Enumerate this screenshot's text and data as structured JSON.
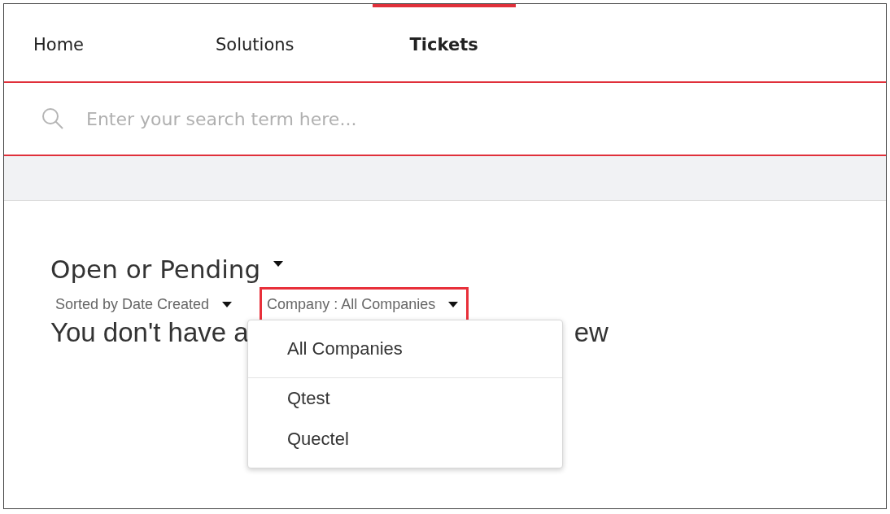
{
  "tabs": [
    {
      "label": "Home",
      "selected": false
    },
    {
      "label": "Solutions",
      "selected": false
    },
    {
      "label": "Tickets",
      "selected": true
    }
  ],
  "search": {
    "placeholder": "Enter your search term here..."
  },
  "view": {
    "title": "Open or Pending",
    "sort": "Sorted by Date Created",
    "company_filter": {
      "label": "Company : All Companies",
      "highlighted": true
    }
  },
  "message": {
    "start": "You don't have a",
    "end": "ew"
  },
  "company_menu": {
    "items": [
      {
        "label": "All Companies",
        "divider_after": true
      },
      {
        "label": "Qtest",
        "divider_after": false
      },
      {
        "label": "Quectel",
        "divider_after": false
      }
    ]
  }
}
